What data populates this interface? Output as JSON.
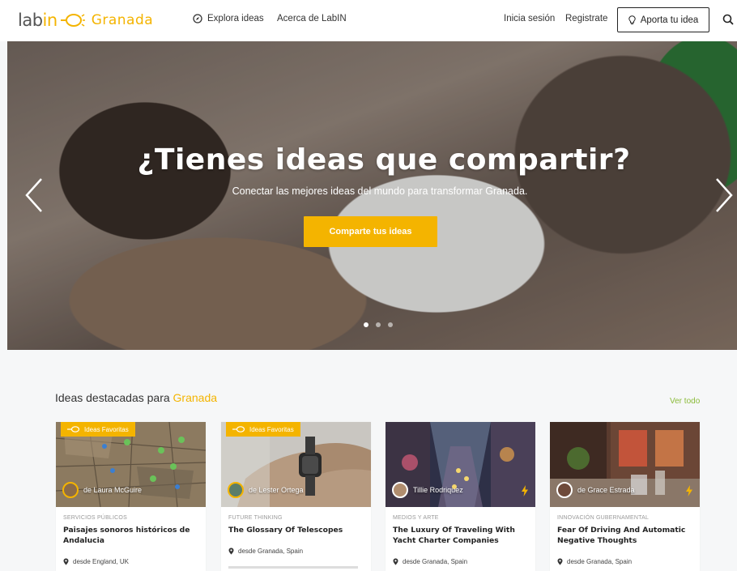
{
  "brand": {
    "logo_text": "labin",
    "city": "Granada",
    "accent": "#f4b400"
  },
  "nav": {
    "explore": "Explora ideas",
    "about": "Acerca de LabIN",
    "login": "Inicia sesión",
    "register": "Registrate",
    "contribute": "Aporta tu idea"
  },
  "hero": {
    "title": "¿Tienes ideas que compartir?",
    "subtitle": "Conectar las mejores ideas del mundo para transformar Granada.",
    "cta": "Comparte tus ideas",
    "slides": 3,
    "active_slide": 1
  },
  "featured": {
    "title_prefix": "Ideas destacadas para",
    "title_city": "Granada",
    "see_all": "Ver todo",
    "cards": [
      {
        "badge": "Ideas Favoritas",
        "author": "de Laura McGuire",
        "category": "SERVICIOS PÚBLICOS",
        "title": "Paisajes sonoros históricos de Andalucia",
        "location": "desde England, UK"
      },
      {
        "badge": "Ideas Favoritas",
        "author": "de Lester Ortega",
        "category": "FUTURE THINKING",
        "title": "The Glossary Of Telescopes",
        "location": "desde Granada, Spain"
      },
      {
        "badge": "",
        "author": "Tillie Rodriquez",
        "category": "MEDIOS Y ARTE",
        "title": "The Luxury Of Traveling With Yacht Charter Companies",
        "location": "desde Granada, Spain"
      },
      {
        "badge": "",
        "author": "de Grace Estrada",
        "category": "INNOVACIÓN GUBERNAMENTAL",
        "title": "Fear Of Driving And Automatic Negative Thoughts",
        "location": "desde Granada, Spain"
      }
    ]
  },
  "icons": [
    "compass-icon",
    "bulb-icon",
    "search-icon",
    "chevron-left-icon",
    "chevron-right-icon",
    "map-pin-icon",
    "bolt-icon"
  ]
}
